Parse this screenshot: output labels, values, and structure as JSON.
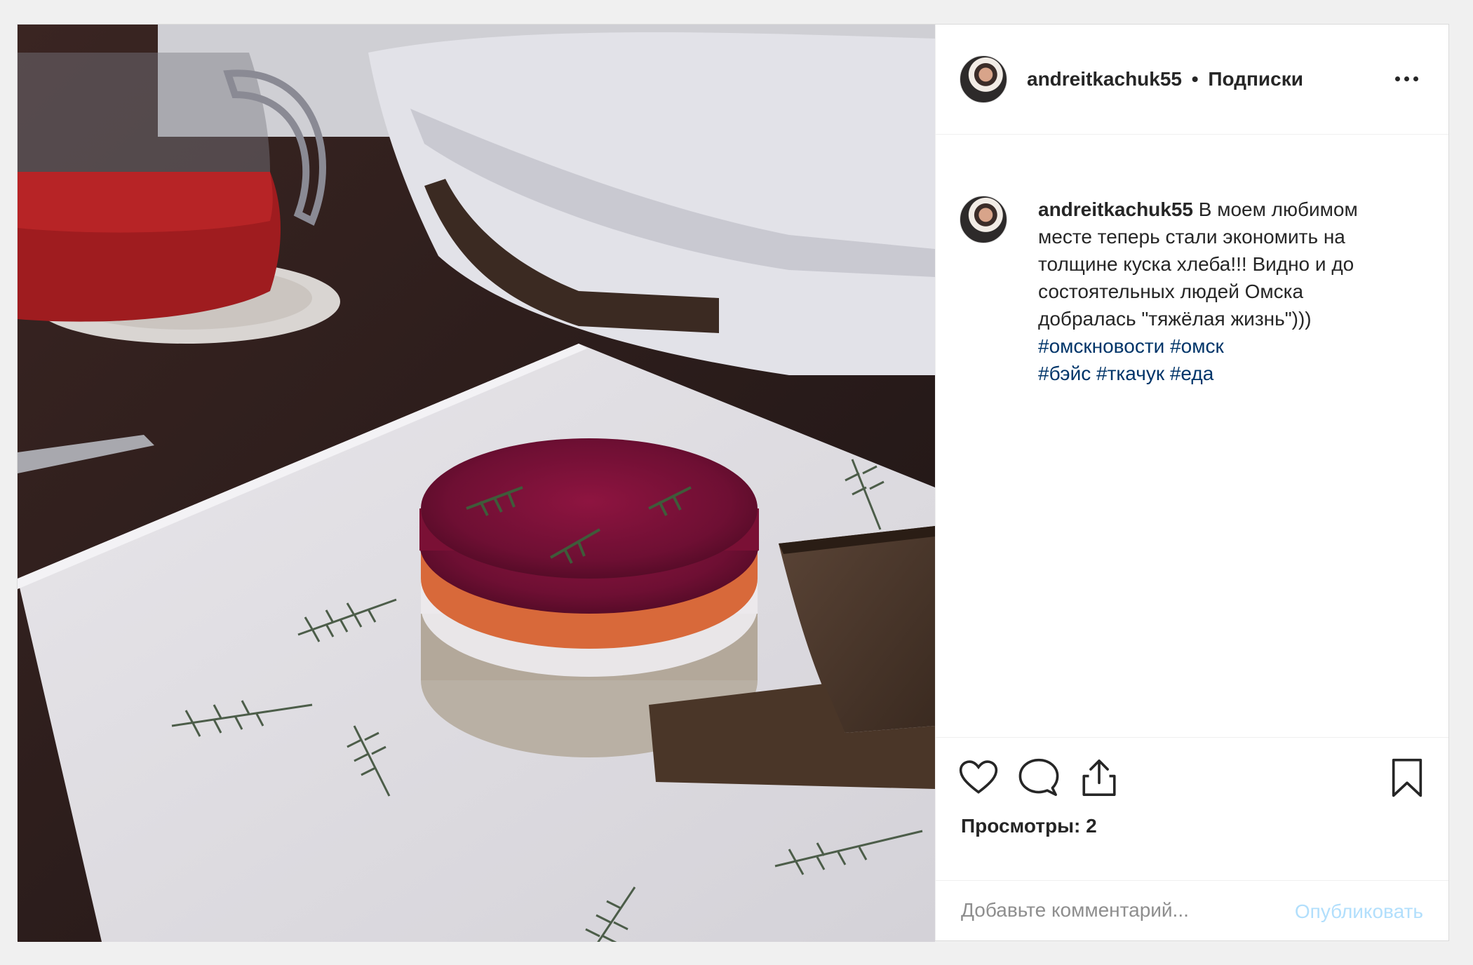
{
  "post": {
    "username": "andreitkachuk55",
    "separator": "•",
    "follow_label": "Подписки",
    "more_icon": "more-horizontal-icon",
    "caption": {
      "author": "andreitkachuk55",
      "text": "В моем любимом месте теперь стали экономить на толщине куска хлеба!!! Видно и до состоятельных людей Омска добралась \"тяжёлая жизнь\")))",
      "hashtags_line1": [
        "#омскновости",
        "#омск"
      ],
      "hashtags_line2": [
        "#бэйс",
        "#ткачук",
        "#еда"
      ]
    },
    "actions": {
      "like_icon": "heart-icon",
      "comment_icon": "comment-bubble-icon",
      "share_icon": "share-upload-icon",
      "save_icon": "bookmark-icon"
    },
    "views_label": "Просмотры: 2",
    "comment": {
      "placeholder": "Добавьте комментарий...",
      "publish_label": "Опубликовать"
    }
  },
  "colors": {
    "hashtag": "#003569",
    "publish_disabled": "#b2dffc",
    "text": "#262626",
    "muted": "#8e8e8e",
    "border": "#dbdbdb"
  }
}
